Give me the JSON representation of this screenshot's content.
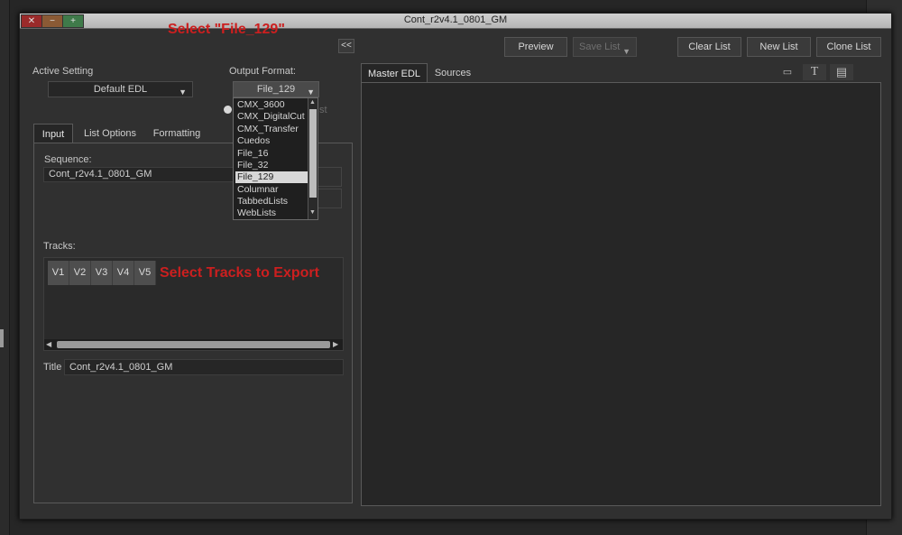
{
  "window": {
    "title": "Cont_r2v4.1_0801_GM",
    "controls": {
      "close": "✕",
      "minimize": "−",
      "maximize": "+"
    }
  },
  "annotations": {
    "select_format": "Select \"File_129\"",
    "select_tracks": "Select Tracks to Export"
  },
  "toolbar": {
    "collapse_label": "<<",
    "preview_label": "Preview",
    "save_list_label": "Save List",
    "clear_list_label": "Clear List",
    "new_list_label": "New List",
    "clone_list_label": "Clone List"
  },
  "settings": {
    "active_setting_label": "Active Setting",
    "active_setting_value": "Default EDL",
    "output_format_label": "Output Format:",
    "output_format_value": "File_129",
    "output_format_options": [
      "CMX_3600",
      "CMX_DigitalCut",
      "CMX_Transfer",
      "Cuedos",
      "File_16",
      "File_32",
      "File_129",
      "Columnar",
      "TabbedLists",
      "WebLists"
    ],
    "selected_option_index": 6,
    "hidden_partial_text": "st"
  },
  "left_tabs": [
    "Input",
    "List Options",
    "Formatting"
  ],
  "input": {
    "sequence_label": "Sequence:",
    "sequence_value": "Cont_r2v4.1_0801_GM",
    "tracks_label": "Tracks:",
    "tracks": [
      "V1",
      "V2",
      "V3",
      "V4",
      "V5"
    ],
    "title_label": "Title",
    "title_value": "Cont_r2v4.1_0801_GM"
  },
  "right_tabs": [
    "Master EDL",
    "Sources"
  ],
  "right_icons": [
    "tape-icon",
    "text-icon",
    "list-icon"
  ],
  "colors": {
    "annotation": "#cc1f1f",
    "background": "#303030",
    "panel": "#262626"
  }
}
